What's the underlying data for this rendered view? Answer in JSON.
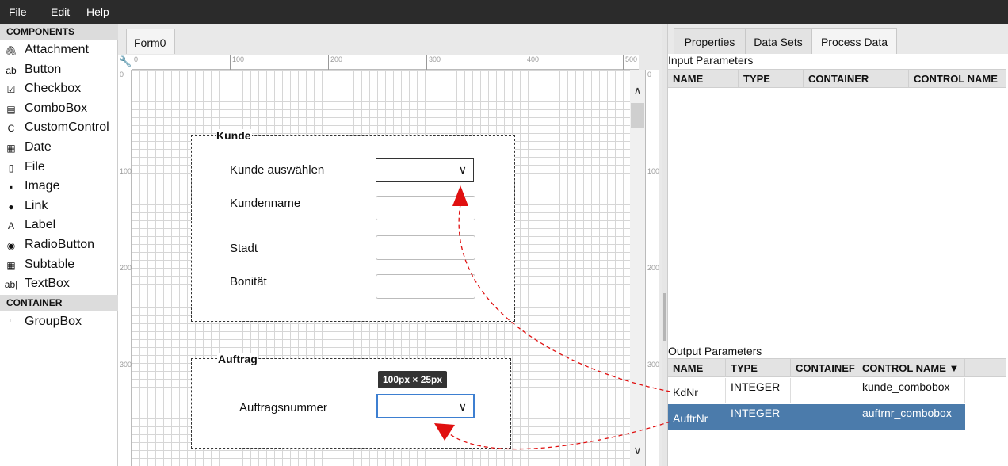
{
  "menubar": {
    "items": [
      "File",
      "Edit",
      "Help"
    ]
  },
  "palette": {
    "components_header": "COMPONENTS",
    "components": [
      {
        "label": "Attachment",
        "icon": "paperclip-icon",
        "glyph": "🖇"
      },
      {
        "label": "Button",
        "icon": "button-icon",
        "glyph": "ab"
      },
      {
        "label": "Checkbox",
        "icon": "checkbox-icon",
        "glyph": "☑"
      },
      {
        "label": "ComboBox",
        "icon": "combobox-icon",
        "glyph": "▤"
      },
      {
        "label": "CustomControl",
        "icon": "custom-control-icon",
        "glyph": "C"
      },
      {
        "label": "Date",
        "icon": "calendar-icon",
        "glyph": "▦"
      },
      {
        "label": "File",
        "icon": "file-icon",
        "glyph": "▯"
      },
      {
        "label": "Image",
        "icon": "image-icon",
        "glyph": "▪"
      },
      {
        "label": "Link",
        "icon": "link-icon",
        "glyph": "●"
      },
      {
        "label": "Label",
        "icon": "label-icon",
        "glyph": "A"
      },
      {
        "label": "RadioButton",
        "icon": "radio-icon",
        "glyph": "◉"
      },
      {
        "label": "Subtable",
        "icon": "table-icon",
        "glyph": "▦"
      },
      {
        "label": "TextBox",
        "icon": "textbox-icon",
        "glyph": "ab|"
      }
    ],
    "container_header": "CONTAINER",
    "containers": [
      {
        "label": "GroupBox",
        "icon": "groupbox-icon",
        "glyph": "⌜"
      }
    ]
  },
  "designer": {
    "tab": "Form0",
    "ruler_h": [
      "0",
      "100",
      "200",
      "300",
      "400",
      "500"
    ],
    "ruler_v": [
      "0",
      "100",
      "200",
      "300"
    ],
    "size_tooltip": "100px × 25px",
    "groups": [
      {
        "title": "Kunde",
        "fields": [
          {
            "label": "Kunde auswählen",
            "kind": "combo"
          },
          {
            "label": "Kundenname",
            "kind": "text"
          },
          {
            "label": "Stadt",
            "kind": "text"
          },
          {
            "label": "Bonität",
            "kind": "text"
          }
        ]
      },
      {
        "title": "Auftrag",
        "fields": [
          {
            "label": "Auftragsnummer",
            "kind": "combo"
          }
        ]
      }
    ]
  },
  "right_panel": {
    "tabs": [
      "Properties",
      "Data Sets",
      "Process Data"
    ],
    "active_tab": "Process Data",
    "input_caption": "Input Parameters",
    "input_columns": [
      "NAME",
      "TYPE",
      "CONTAINER",
      "CONTROL NAME"
    ],
    "output_caption": "Output Parameters",
    "output_columns": [
      "NAME",
      "TYPE",
      "CONTAINEF",
      "CONTROL NAME ▼"
    ],
    "output_rows": [
      {
        "name": "KdNr",
        "type": "INTEGER",
        "container": "",
        "control": "kunde_combobox",
        "selected": false
      },
      {
        "name": "AuftrNr",
        "type": "INTEGER",
        "container": "",
        "control": "auftrnr_combobox",
        "selected": true
      }
    ]
  },
  "colors": {
    "menubar": "#2b2b2b",
    "selection": "#4b7bab",
    "arrow": "#e01010",
    "focus": "#3d7fd1"
  }
}
